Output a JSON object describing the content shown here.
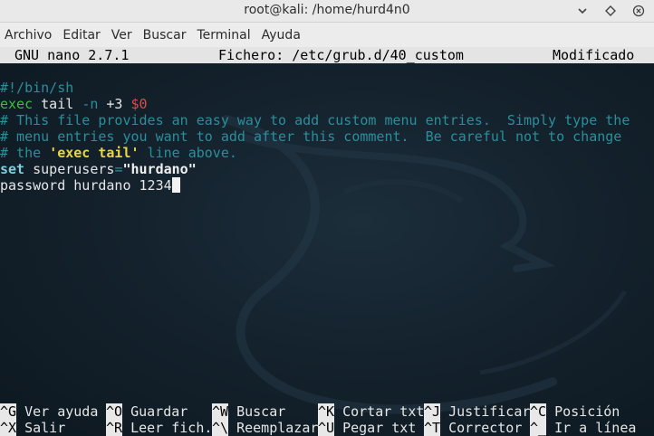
{
  "window": {
    "title": "root@kali: /home/hurd4n0",
    "minimize_icon": "chevron-down-icon",
    "maximize_icon": "maximize-icon",
    "close_icon": "close-icon"
  },
  "menubar": {
    "items": [
      "Archivo",
      "Editar",
      "Ver",
      "Buscar",
      "Terminal",
      "Ayuda"
    ]
  },
  "nano": {
    "version": "GNU nano 2.7.1",
    "file": "Fichero: /etc/grub.d/40_custom",
    "status": "Modificado",
    "lines": {
      "shebang": "#!/bin/sh",
      "exec_kw": "exec",
      "tail_cmd": " tail ",
      "tail_flag": "-n",
      "tail_arg": " +3 ",
      "tail_var": "$0",
      "comment1": "# This file provides an easy way to add custom menu entries.  Simply type the",
      "comment2": "# menu entries you want to add after this comment.  Be careful not to change",
      "comment3a": "# the ",
      "comment3b": "'exec tail'",
      "comment3c": " line above.",
      "set_kw": "set",
      "set_var": " superusers",
      "set_eq": "=",
      "set_val": "\"hurdano\"",
      "password_line": "password hurdano 1234"
    },
    "shortcuts_row1": [
      {
        "key": "^G",
        "label": " Ver ayuda"
      },
      {
        "key": "^O",
        "label": " Guardar"
      },
      {
        "key": "^W",
        "label": " Buscar"
      },
      {
        "key": "^K",
        "label": " Cortar txt"
      },
      {
        "key": "^J",
        "label": " Justificar"
      },
      {
        "key": "^C",
        "label": " Posición"
      }
    ],
    "shortcuts_row2": [
      {
        "key": "^X",
        "label": " Salir"
      },
      {
        "key": "^R",
        "label": " Leer fich."
      },
      {
        "key": "^\\",
        "label": " Reemplazar"
      },
      {
        "key": "^U",
        "label": " Pegar txt"
      },
      {
        "key": "^T",
        "label": " Corrector"
      },
      {
        "key": "^_",
        "label": " Ir a línea"
      }
    ]
  }
}
